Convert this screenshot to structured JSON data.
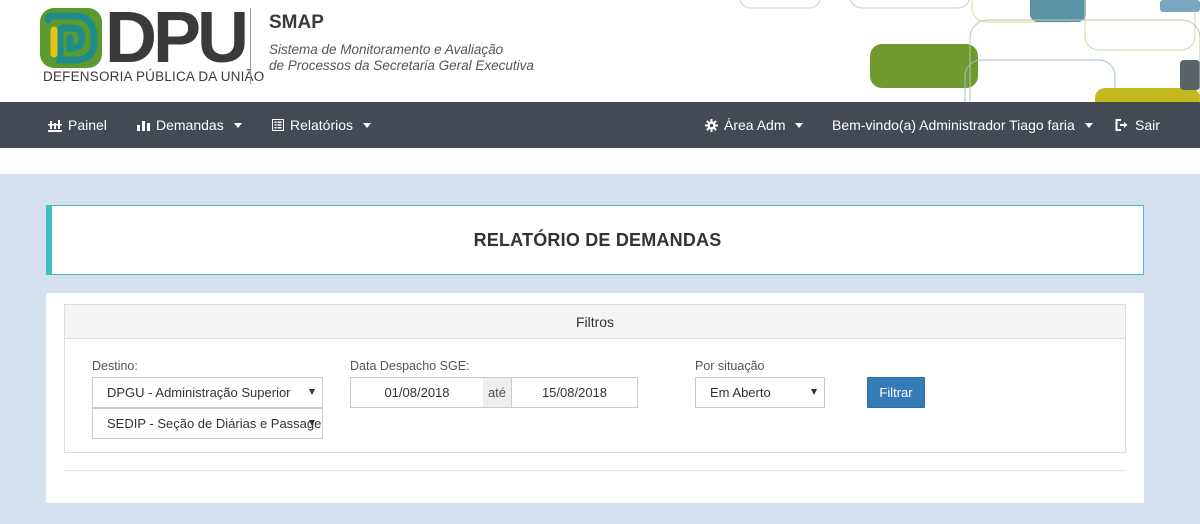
{
  "header": {
    "logo_text": "DPU",
    "logo_subtitle": "DEFENSORIA PÚBLICA DA UNIÃO",
    "app_name": "SMAP",
    "app_description_line1": "Sistema de Monitoramento e Avaliação",
    "app_description_line2": "de Processos da Secretaria Geral Executiva"
  },
  "navbar": {
    "painel": "Painel",
    "demandas": "Demandas",
    "relatorios": "Relatórios",
    "area_adm": "Área Adm",
    "welcome": "Bem-vindo(a) Administrador Tiago faria",
    "sair": "Sair"
  },
  "page": {
    "title": "RELATÓRIO DE DEMANDAS"
  },
  "filters": {
    "heading": "Filtros",
    "destino_label": "Destino:",
    "destino_value": "DPGU - Administração Superior",
    "subdestino_value": "SEDIP - Seção de Diárias e Passagens",
    "data_label": "Data Despacho SGE:",
    "date_from": "01/08/2018",
    "date_sep": "até",
    "date_to": "15/08/2018",
    "situacao_label": "Por situação",
    "situacao_value": "Em Aberto",
    "filter_button": "Filtrar"
  },
  "colors": {
    "navbar_bg": "#434a54",
    "page_bg": "#d5e0ee",
    "accent_teal": "#3bbfc0",
    "button_blue": "#337ab7",
    "logo_green": "#5a9a2e",
    "logo_teal": "#1f8c8a",
    "logo_yellow": "#e3c417"
  },
  "icons": {
    "painel": "dashboard-icon",
    "demandas": "bar-chart-icon",
    "relatorios": "report-list-icon",
    "area_adm": "gear-icon",
    "sair": "sign-out-icon"
  }
}
